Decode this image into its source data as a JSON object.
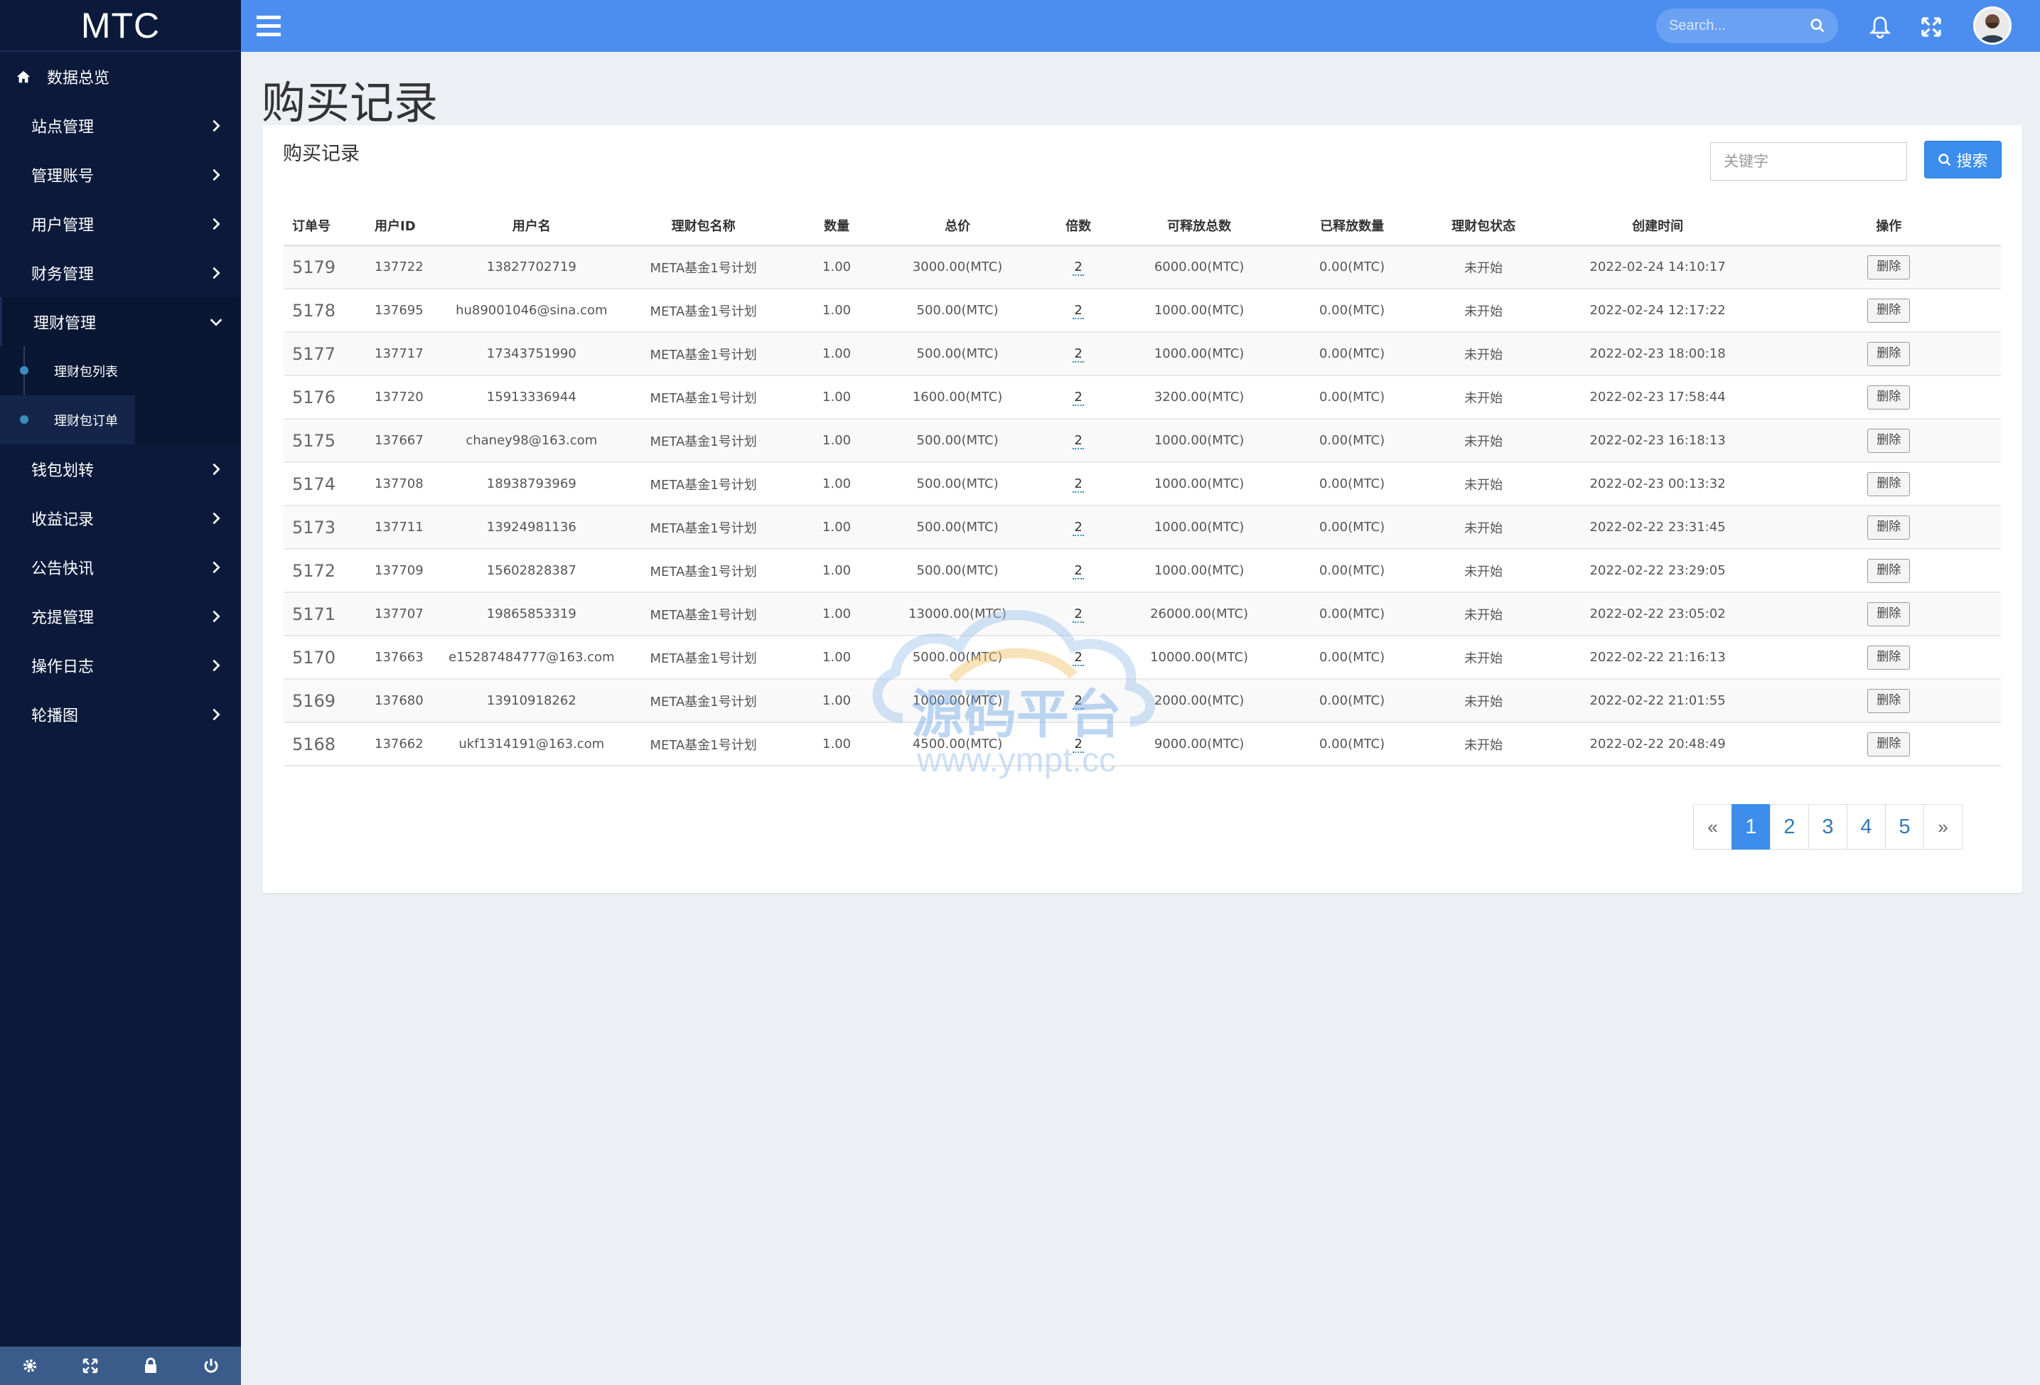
{
  "app": {
    "brand": "MTC"
  },
  "sidebar": {
    "items": [
      {
        "label": "数据总览",
        "icon": "home-icon"
      },
      {
        "label": "站点管理"
      },
      {
        "label": "管理账号"
      },
      {
        "label": "用户管理"
      },
      {
        "label": "财务管理"
      },
      {
        "label": "理财管理",
        "open": true,
        "children": [
          {
            "label": "理财包列表"
          },
          {
            "label": "理财包订单",
            "active": true
          }
        ]
      },
      {
        "label": "钱包划转"
      },
      {
        "label": "收益记录"
      },
      {
        "label": "公告快讯"
      },
      {
        "label": "充提管理"
      },
      {
        "label": "操作日志"
      },
      {
        "label": "轮播图"
      }
    ],
    "footer_icons": [
      "gear-icon",
      "expand-icon",
      "lock-icon",
      "power-icon"
    ]
  },
  "topbar": {
    "search_placeholder": "Search..."
  },
  "page": {
    "title": "购买记录"
  },
  "box": {
    "title": "购买记录",
    "keyword_placeholder": "关键字",
    "search_button": "搜索"
  },
  "table": {
    "headers": [
      "订单号",
      "用户ID",
      "用户名",
      "理财包名称",
      "数量",
      "总价",
      "倍数",
      "可释放总数",
      "已释放数量",
      "理财包状态",
      "创建时间",
      "操作"
    ],
    "rows": [
      {
        "id": "5179",
        "uid": "137722",
        "user": "13827702719",
        "pkg": "META基金1号计划",
        "qty": "1.00",
        "total": "3000.00(MTC)",
        "multi": "2",
        "releasable": "6000.00(MTC)",
        "released": "0.00(MTC)",
        "status": "未开始",
        "time": "2022-02-24 14:10:17",
        "action": "删除"
      },
      {
        "id": "5178",
        "uid": "137695",
        "user": "hu89001046@sina.com",
        "pkg": "META基金1号计划",
        "qty": "1.00",
        "total": "500.00(MTC)",
        "multi": "2",
        "releasable": "1000.00(MTC)",
        "released": "0.00(MTC)",
        "status": "未开始",
        "time": "2022-02-24 12:17:22",
        "action": "删除"
      },
      {
        "id": "5177",
        "uid": "137717",
        "user": "17343751990",
        "pkg": "META基金1号计划",
        "qty": "1.00",
        "total": "500.00(MTC)",
        "multi": "2",
        "releasable": "1000.00(MTC)",
        "released": "0.00(MTC)",
        "status": "未开始",
        "time": "2022-02-23 18:00:18",
        "action": "删除"
      },
      {
        "id": "5176",
        "uid": "137720",
        "user": "15913336944",
        "pkg": "META基金1号计划",
        "qty": "1.00",
        "total": "1600.00(MTC)",
        "multi": "2",
        "releasable": "3200.00(MTC)",
        "released": "0.00(MTC)",
        "status": "未开始",
        "time": "2022-02-23 17:58:44",
        "action": "删除"
      },
      {
        "id": "5175",
        "uid": "137667",
        "user": "chaney98@163.com",
        "pkg": "META基金1号计划",
        "qty": "1.00",
        "total": "500.00(MTC)",
        "multi": "2",
        "releasable": "1000.00(MTC)",
        "released": "0.00(MTC)",
        "status": "未开始",
        "time": "2022-02-23 16:18:13",
        "action": "删除"
      },
      {
        "id": "5174",
        "uid": "137708",
        "user": "18938793969",
        "pkg": "META基金1号计划",
        "qty": "1.00",
        "total": "500.00(MTC)",
        "multi": "2",
        "releasable": "1000.00(MTC)",
        "released": "0.00(MTC)",
        "status": "未开始",
        "time": "2022-02-23 00:13:32",
        "action": "删除"
      },
      {
        "id": "5173",
        "uid": "137711",
        "user": "13924981136",
        "pkg": "META基金1号计划",
        "qty": "1.00",
        "total": "500.00(MTC)",
        "multi": "2",
        "releasable": "1000.00(MTC)",
        "released": "0.00(MTC)",
        "status": "未开始",
        "time": "2022-02-22 23:31:45",
        "action": "删除"
      },
      {
        "id": "5172",
        "uid": "137709",
        "user": "15602828387",
        "pkg": "META基金1号计划",
        "qty": "1.00",
        "total": "500.00(MTC)",
        "multi": "2",
        "releasable": "1000.00(MTC)",
        "released": "0.00(MTC)",
        "status": "未开始",
        "time": "2022-02-22 23:29:05",
        "action": "删除"
      },
      {
        "id": "5171",
        "uid": "137707",
        "user": "19865853319",
        "pkg": "META基金1号计划",
        "qty": "1.00",
        "total": "13000.00(MTC)",
        "multi": "2",
        "releasable": "26000.00(MTC)",
        "released": "0.00(MTC)",
        "status": "未开始",
        "time": "2022-02-22 23:05:02",
        "action": "删除"
      },
      {
        "id": "5170",
        "uid": "137663",
        "user": "e15287484777@163.com",
        "pkg": "META基金1号计划",
        "qty": "1.00",
        "total": "5000.00(MTC)",
        "multi": "2",
        "releasable": "10000.00(MTC)",
        "released": "0.00(MTC)",
        "status": "未开始",
        "time": "2022-02-22 21:16:13",
        "action": "删除"
      },
      {
        "id": "5169",
        "uid": "137680",
        "user": "13910918262",
        "pkg": "META基金1号计划",
        "qty": "1.00",
        "total": "1000.00(MTC)",
        "multi": "2",
        "releasable": "2000.00(MTC)",
        "released": "0.00(MTC)",
        "status": "未开始",
        "time": "2022-02-22 21:01:55",
        "action": "删除"
      },
      {
        "id": "5168",
        "uid": "137662",
        "user": "ukf1314191@163.com",
        "pkg": "META基金1号计划",
        "qty": "1.00",
        "total": "4500.00(MTC)",
        "multi": "2",
        "releasable": "9000.00(MTC)",
        "released": "0.00(MTC)",
        "status": "未开始",
        "time": "2022-02-22 20:48:49",
        "action": "删除"
      }
    ]
  },
  "pagination": {
    "prev": "«",
    "pages": [
      "1",
      "2",
      "3",
      "4",
      "5"
    ],
    "current": "1",
    "next": "»"
  },
  "watermark": {
    "line1": "源码平台",
    "line2": "www.ympt.cc"
  },
  "colors": {
    "sidebar": "#0b1a3a",
    "topbar": "#4c8ef0",
    "accent": "#3c8dec"
  }
}
